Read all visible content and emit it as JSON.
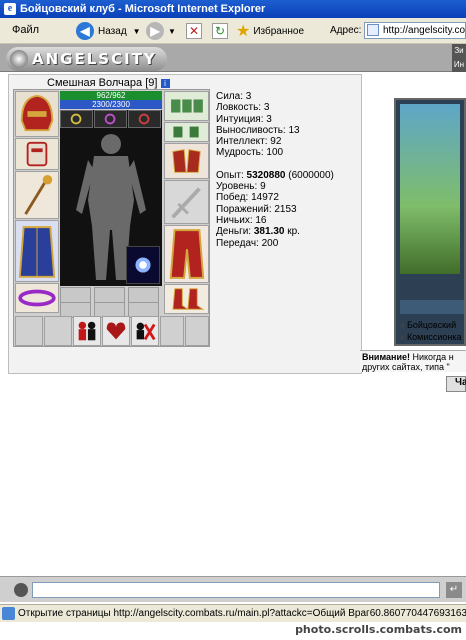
{
  "window": {
    "title": "Бойцовский клуб - Microsoft Internet Explorer"
  },
  "menu": {
    "file": "Файл"
  },
  "toolbar": {
    "back": "Назад",
    "favorites": "Избранное",
    "address_label": "Адрес:",
    "address_value": "http://angelscity.com"
  },
  "site": {
    "logo": "ANGELSCITY",
    "banner_right": "Зи Ин"
  },
  "character": {
    "name": "Смешная Волчара",
    "level": "[9]",
    "hp": "962/962",
    "mana": "2300/2300"
  },
  "stats": {
    "strength": "Сила: 3",
    "agility": "Ловкость: 3",
    "intuition": "Интуиция: 3",
    "endurance": "Выносливость: 13",
    "intellect": "Интеллект: 92",
    "wisdom": "Мудрость: 100",
    "exp_label": "Опыт: ",
    "exp_value": "5320880",
    "exp_next": " (6000000)",
    "level": "Уровень: 9",
    "wins": "Побед: 14972",
    "losses": "Поражений: 2153",
    "draws": "Ничьих: 16",
    "money_label": "Деньги: ",
    "money_value": "381.30",
    "money_unit": " кр.",
    "transfers": "Передач: 200"
  },
  "right_links": {
    "club": "Бойцовский",
    "commission": "Комиссионка"
  },
  "notice": {
    "bold": "Внимание!",
    "text1": " Никогда н",
    "text2": "других сайтах, типа \""
  },
  "tab": {
    "chat": "Ча"
  },
  "chat_input": {
    "placeholder": ""
  },
  "status": {
    "text": "Открытие страницы http://angelscity.combats.ru/main.pl?attackc=Общий Враг60.860770447693163..."
  },
  "watermark": "photo.scrolls.combats.com",
  "colors": {
    "titlebar": "#0a3fb8",
    "hp": "#1b8e2f",
    "mana": "#2b57c7"
  }
}
